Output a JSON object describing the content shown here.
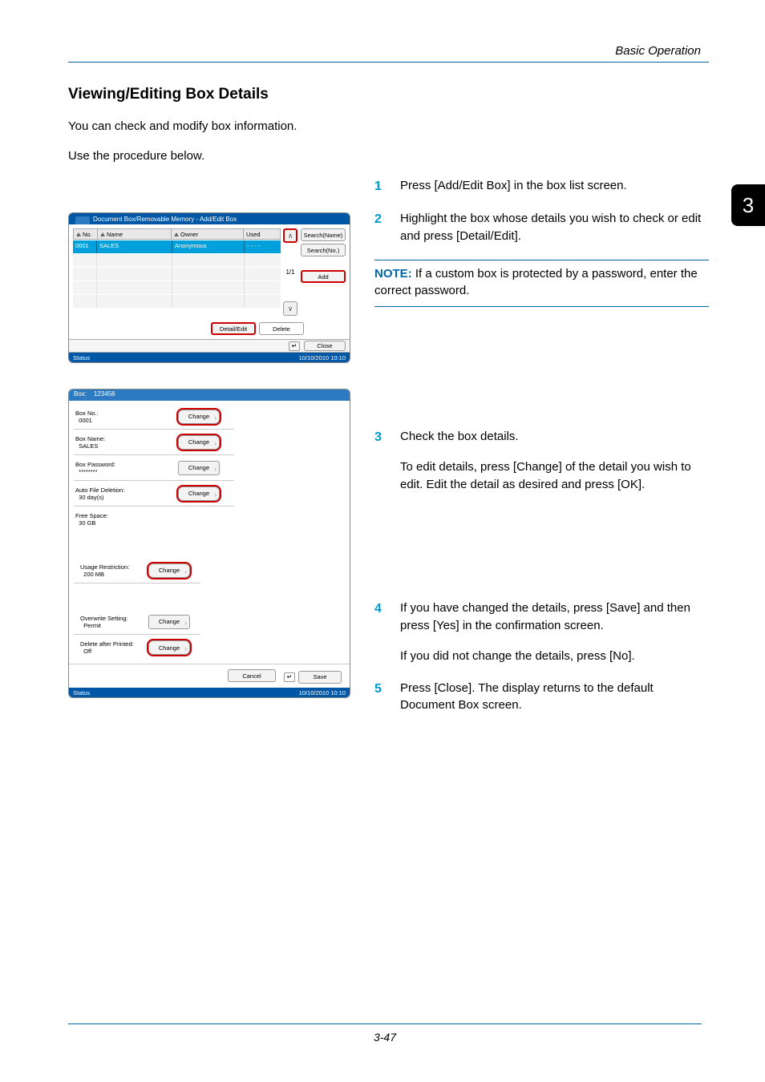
{
  "breadcrumb": "Basic Operation",
  "chapter_badge": "3",
  "section_title": "Viewing/Editing Box Details",
  "intro1": "You can check and modify box information.",
  "intro2": "Use the procedure below.",
  "steps": {
    "s1": {
      "n": "1",
      "text": "Press [Add/Edit Box] in the box list screen."
    },
    "s2": {
      "n": "2",
      "text": "Highlight the box whose details you wish to check or edit and press [Detail/Edit]."
    },
    "s3": {
      "n": "3",
      "text1": "Check the box details.",
      "text2": "To edit details, press [Change] of the detail you wish to edit. Edit the detail as desired and press [OK]."
    },
    "s4": {
      "n": "4",
      "text1": "If you have changed the details, press [Save] and then press [Yes] in the confirmation screen.",
      "text2": "If you did not change the details, press [No]."
    },
    "s5": {
      "n": "5",
      "text": "Press [Close]. The display returns to the default Document Box screen."
    }
  },
  "note": {
    "label": "NOTE:",
    "text": " If a custom box is protected by a password, enter the correct password."
  },
  "shot1": {
    "title": "Document Box/Removable Memory - Add/Edit Box",
    "cols": {
      "no": "No.",
      "name": "Name",
      "owner": "Owner",
      "used": "Used"
    },
    "row": {
      "no": "0001",
      "name": "SALES",
      "owner": "Anonymous",
      "used": "- - - -"
    },
    "page": "1/1",
    "btn_search_name": "Search(Name)",
    "btn_search_no": "Search(No.)",
    "btn_add": "Add",
    "btn_detail": "Detail/Edit",
    "btn_delete": "Delete",
    "close": "Close",
    "status": "Status",
    "timestamp": "10/10/2010   10:10"
  },
  "shot2": {
    "box_head": "Box:",
    "box_head_val": "123456",
    "labels": {
      "box_no": "Box No.:",
      "box_no_v": "0001",
      "box_name": "Box Name:",
      "box_name_v": "SALES",
      "box_pw": "Box Password:",
      "box_pw_v": "********",
      "auto_del": "Auto File Deletion:",
      "auto_del_v": "30   day(s)",
      "free": "Free Space:",
      "free_v": "30  GB",
      "usage": "Usage Restriction:",
      "usage_v": "200  MB",
      "over": "Overwrite Setting:",
      "over_v": "Permit",
      "dap": "Delete after Printed:",
      "dap_v": "Off"
    },
    "change": "Change",
    "cancel": "Cancel",
    "save": "Save",
    "status": "Status",
    "timestamp": "10/10/2010   10:10"
  },
  "page_number": "3-47"
}
